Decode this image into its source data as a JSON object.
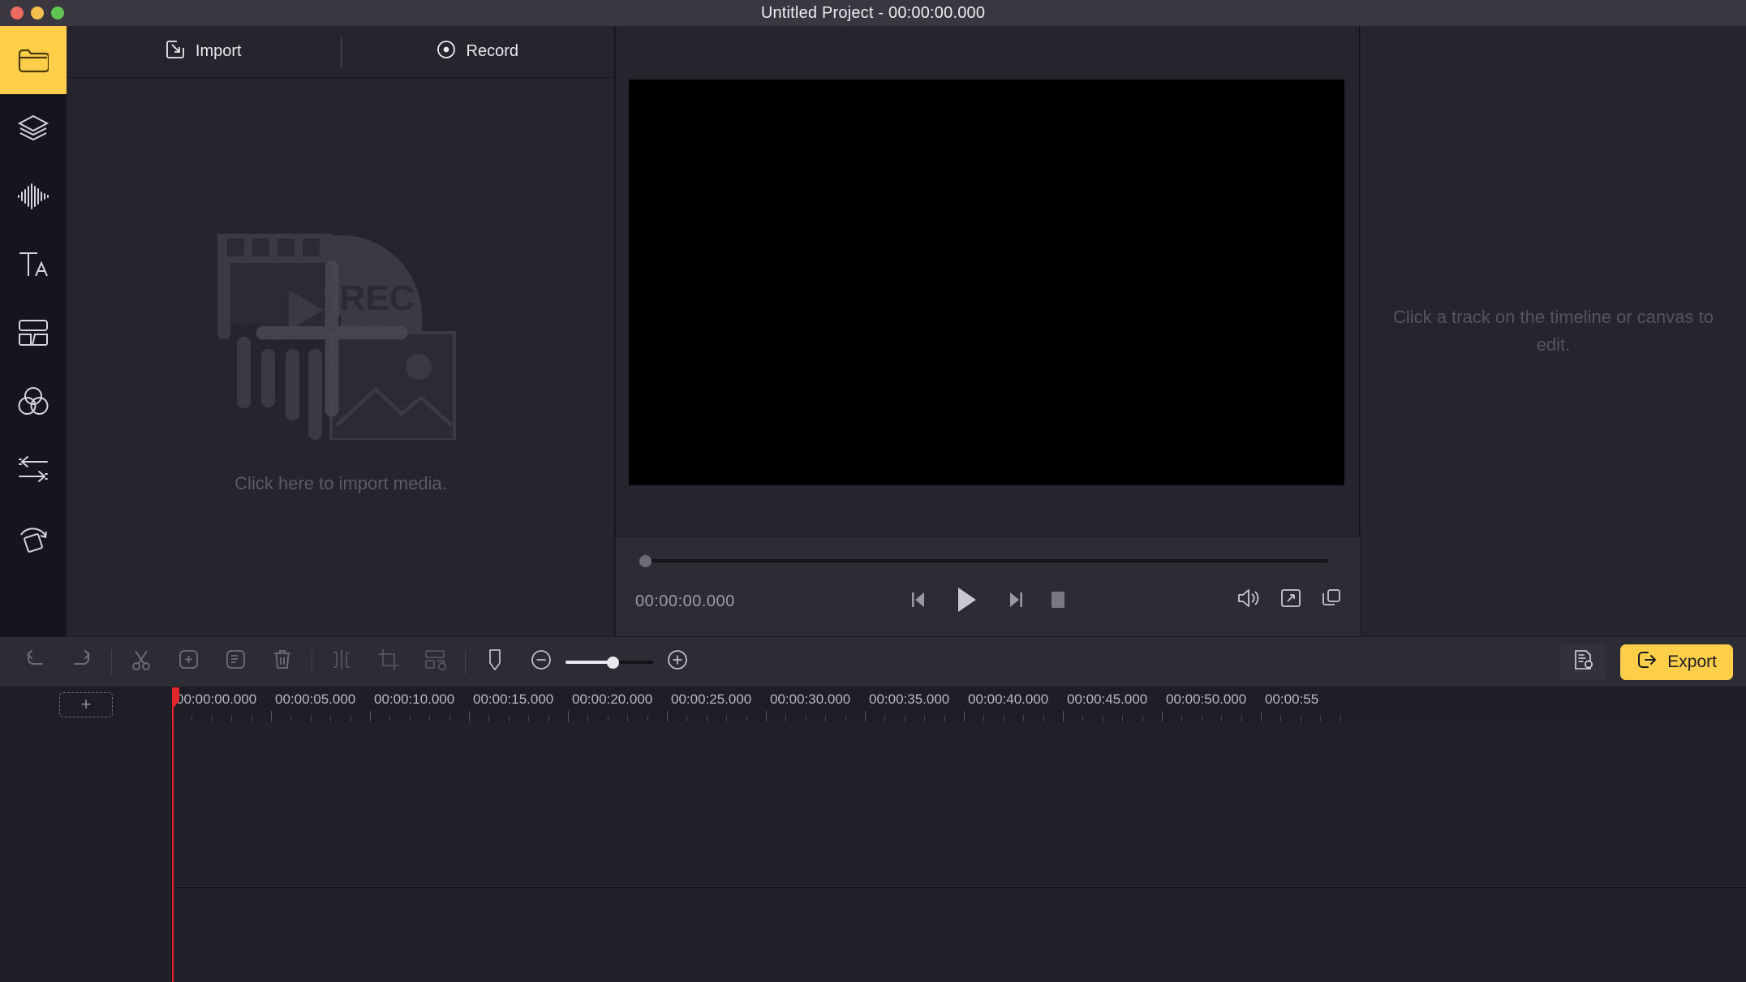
{
  "window": {
    "title": "Untitled Project - 00:00:00.000",
    "traffic_lights": [
      "close",
      "minimize",
      "maximize"
    ],
    "colors": {
      "accent": "#ffcf4a",
      "playhead": "#e4262c",
      "panel": "#26242c",
      "titlebar": "#3a3740"
    }
  },
  "sidebar": {
    "items": [
      {
        "icon": "folder-icon",
        "name": "media",
        "active": true
      },
      {
        "icon": "layers-icon",
        "name": "elements",
        "active": false
      },
      {
        "icon": "audio-waveform-icon",
        "name": "audio",
        "active": false
      },
      {
        "icon": "text-icon",
        "name": "text",
        "active": false
      },
      {
        "icon": "split-layout-icon",
        "name": "templates",
        "active": false
      },
      {
        "icon": "color-circles-icon",
        "name": "filters",
        "active": false
      },
      {
        "icon": "transitions-arrows-icon",
        "name": "transitions",
        "active": false
      },
      {
        "icon": "rotate-square-icon",
        "name": "transform",
        "active": false
      }
    ]
  },
  "media_panel": {
    "tabs": [
      {
        "label": "Import",
        "icon": "import-arrow-icon",
        "active": true
      },
      {
        "label": "Record",
        "icon": "record-dot-icon",
        "active": false
      }
    ],
    "drop_caption": "Click here to import media.",
    "placeholder_rec_label": "REC"
  },
  "preview": {
    "timecode": "00:00:00.000",
    "scrub_position_percent": 0,
    "transport": [
      {
        "name": "previous-frame",
        "icon": "step-back-icon"
      },
      {
        "name": "play",
        "icon": "play-icon"
      },
      {
        "name": "next-frame",
        "icon": "step-forward-icon"
      },
      {
        "name": "stop",
        "icon": "stop-icon"
      }
    ],
    "view_icons": [
      {
        "name": "volume",
        "icon": "speaker-icon"
      },
      {
        "name": "fullscreen",
        "icon": "expand-icon"
      },
      {
        "name": "snapshot",
        "icon": "copy-frames-icon"
      }
    ]
  },
  "properties": {
    "hint": "Click a track on the timeline or canvas to edit."
  },
  "toolbar": {
    "groups": [
      [
        {
          "name": "undo",
          "icon": "undo-icon"
        },
        {
          "name": "redo",
          "icon": "redo-icon"
        }
      ],
      [
        {
          "name": "cut",
          "icon": "scissors-icon"
        },
        {
          "name": "duplicate",
          "icon": "add-clip-icon"
        },
        {
          "name": "copy",
          "icon": "copy-icon"
        },
        {
          "name": "delete",
          "icon": "trash-icon"
        }
      ],
      [
        {
          "name": "split",
          "icon": "split-icon"
        },
        {
          "name": "crop",
          "icon": "crop-icon"
        },
        {
          "name": "layout-settings",
          "icon": "layout-gear-icon"
        }
      ],
      [
        {
          "name": "marker",
          "icon": "marker-icon"
        }
      ]
    ],
    "zoom": {
      "out_icon": "zoom-out-icon",
      "in_icon": "zoom-in-icon",
      "value_percent": 53
    },
    "settings_label": "",
    "settings_icon": "project-settings-icon",
    "export_label": "Export",
    "export_icon": "export-arrow-icon"
  },
  "timeline": {
    "add_track_label": "+",
    "playhead_time": "00:00:00.000",
    "ruler": {
      "pixels_per_tick": 122,
      "ticks": [
        "00:00:00.000",
        "00:00:05.000",
        "00:00:10.000",
        "00:00:15.000",
        "00:00:20.000",
        "00:00:25.000",
        "00:00:30.000",
        "00:00:35.000",
        "00:00:40.000",
        "00:00:45.000",
        "00:00:50.000",
        "00:00:55"
      ]
    },
    "tracks": [
      {
        "name": "track-row-1",
        "clips": []
      },
      {
        "name": "track-row-2",
        "clips": []
      }
    ]
  }
}
